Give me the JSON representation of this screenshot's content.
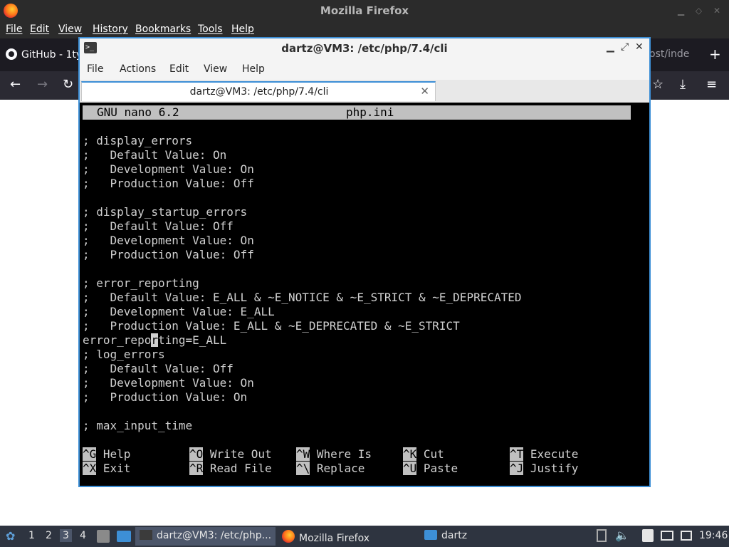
{
  "firefox": {
    "title": "Mozilla Firefox",
    "menu": [
      "File",
      "Edit",
      "View",
      "History",
      "Bookmarks",
      "Tools",
      "Help"
    ],
    "tab_left_label": "GitHub - 1ty",
    "tab_right_label": "ost/inde"
  },
  "terminal": {
    "title": "dartz@VM3: /etc/php/7.4/cli",
    "menu": [
      "File",
      "Actions",
      "Edit",
      "View",
      "Help"
    ],
    "tab_label": "dartz@VM3: /etc/php/7.4/cli"
  },
  "nano": {
    "version": "GNU nano 6.2",
    "filename": "php.ini",
    "lines": [
      "; display_errors",
      ";   Default Value: On",
      ";   Development Value: On",
      ";   Production Value: Off",
      "",
      "; display_startup_errors",
      ";   Default Value: Off",
      ";   Development Value: On",
      ";   Production Value: Off",
      "",
      "; error_reporting",
      ";   Default Value: E_ALL & ~E_NOTICE & ~E_STRICT & ~E_DEPRECATED",
      ";   Development Value: E_ALL",
      ";   Production Value: E_ALL & ~E_DEPRECATED & ~E_STRICT",
      "error_reporting=E_ALL",
      "; log_errors",
      ";   Default Value: Off",
      ";   Development Value: On",
      ";   Production Value: On",
      "",
      "; max_input_time"
    ],
    "cursor": {
      "line": 14,
      "column": 10
    },
    "shortcuts_row1": [
      {
        "key": "^G",
        "label": "Help"
      },
      {
        "key": "^O",
        "label": "Write Out"
      },
      {
        "key": "^W",
        "label": "Where Is"
      },
      {
        "key": "^K",
        "label": "Cut"
      },
      {
        "key": "^T",
        "label": "Execute"
      }
    ],
    "shortcuts_row2": [
      {
        "key": "^X",
        "label": "Exit"
      },
      {
        "key": "^R",
        "label": "Read File"
      },
      {
        "key": "^\\",
        "label": "Replace"
      },
      {
        "key": "^U",
        "label": "Paste"
      },
      {
        "key": "^J",
        "label": "Justify"
      }
    ]
  },
  "taskbar": {
    "desktops": [
      "1",
      "2",
      "3",
      "4"
    ],
    "active_desktop": "3",
    "tasks": [
      "dartz@VM3: /etc/php...",
      "Mozilla Firefox",
      "dartz"
    ],
    "clock": "19:46"
  }
}
